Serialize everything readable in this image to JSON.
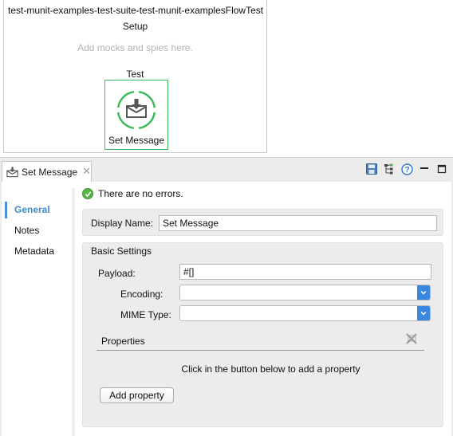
{
  "flow": {
    "title": "test-munit-examples-test-suite-test-munit-examplesFlowTest",
    "setup_label": "Setup",
    "mocks_hint": "Add mocks and spies here.",
    "test_label": "Test",
    "processor": {
      "label": "Set Message",
      "icon": "set-message-icon",
      "accent": "#3fba5b"
    }
  },
  "properties_view": {
    "tab": {
      "label": "Set Message",
      "icon": "set-message-icon",
      "close_icon": "close-icon"
    },
    "toolbar": [
      "save-icon",
      "tree-icon",
      "help-icon",
      "minimize-icon",
      "maximize-icon"
    ],
    "nav": [
      {
        "label": "General",
        "active": true
      },
      {
        "label": "Notes",
        "active": false
      },
      {
        "label": "Metadata",
        "active": false
      }
    ],
    "status": {
      "text": "There are no errors.",
      "icon": "check-icon",
      "color": "#5ab54a"
    },
    "display_name": {
      "label": "Display Name:",
      "value": "Set Message"
    },
    "basic_settings": {
      "title": "Basic Settings",
      "payload": {
        "label": "Payload:",
        "value": "#[]"
      },
      "encoding": {
        "label": "Encoding:",
        "value": ""
      },
      "mime_type": {
        "label": "MIME Type:",
        "value": ""
      },
      "properties": {
        "title": "Properties",
        "hint": "Click in the button below to add a property",
        "add_button": "Add property",
        "remove_icon": "remove-property-icon"
      }
    },
    "accent": "#3b86e0"
  }
}
